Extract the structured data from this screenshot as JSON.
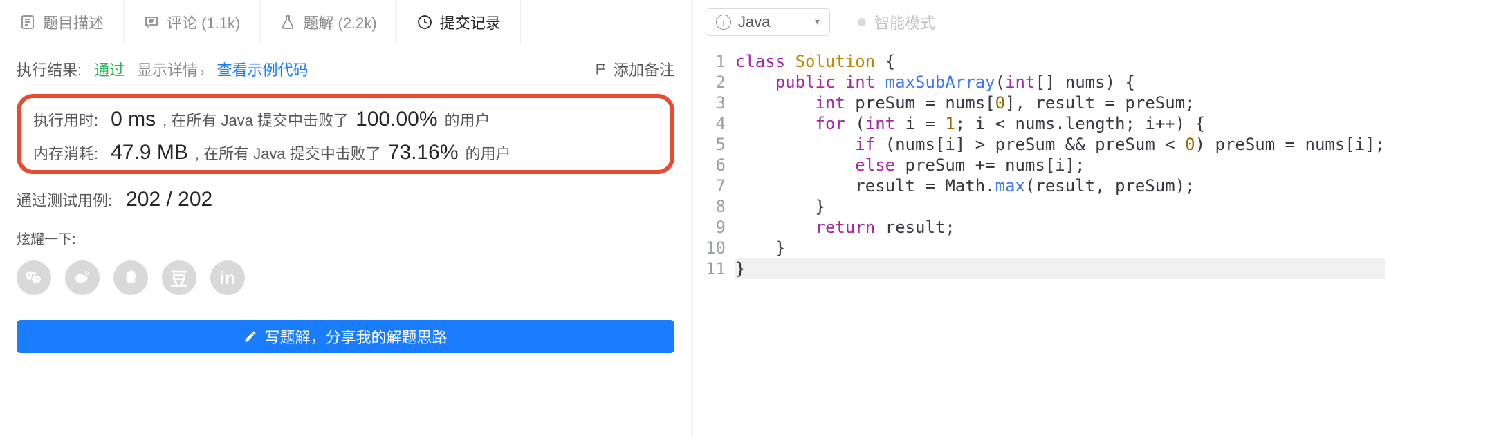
{
  "tabs": {
    "description": "题目描述",
    "comments": "评论 (1.1k)",
    "solutions": "题解 (2.2k)",
    "submissions": "提交记录"
  },
  "result": {
    "label": "执行结果:",
    "status": "通过",
    "show_details": "显示详情",
    "view_sample_code": "查看示例代码",
    "add_note": "添加备注"
  },
  "runtime": {
    "label": "执行用时:",
    "value": "0 ms",
    "prefix": ", 在所有 Java 提交中击败了",
    "percent": "100.00%",
    "suffix": "的用户"
  },
  "memory": {
    "label": "内存消耗:",
    "value": "47.9 MB",
    "prefix": ", 在所有 Java 提交中击败了",
    "percent": "73.16%",
    "suffix": "的用户"
  },
  "testcases": {
    "label": "通过测试用例:",
    "value": "202 / 202"
  },
  "share": {
    "label": "炫耀一下:"
  },
  "write_solution": "写题解，分享我的解题思路",
  "editor": {
    "language": "Java",
    "smart_mode": "智能模式",
    "lines": [
      "1",
      "2",
      "3",
      "4",
      "5",
      "6",
      "7",
      "8",
      "9",
      "10",
      "11"
    ]
  },
  "code_tokens": [
    [
      [
        "k",
        "class"
      ],
      [
        "",
        " "
      ],
      [
        "cls",
        "Solution"
      ],
      [
        "",
        " {"
      ]
    ],
    [
      [
        "",
        "    "
      ],
      [
        "k",
        "public"
      ],
      [
        "",
        " "
      ],
      [
        "t",
        "int"
      ],
      [
        "",
        " "
      ],
      [
        "fn",
        "maxSubArray"
      ],
      [
        "",
        "("
      ],
      [
        "t",
        "int"
      ],
      [
        "",
        "[] nums) {"
      ]
    ],
    [
      [
        "",
        "        "
      ],
      [
        "t",
        "int"
      ],
      [
        "",
        " preSum = nums["
      ],
      [
        "num",
        "0"
      ],
      [
        "",
        "], result = preSum;"
      ]
    ],
    [
      [
        "",
        "        "
      ],
      [
        "k",
        "for"
      ],
      [
        "",
        " ("
      ],
      [
        "t",
        "int"
      ],
      [
        "",
        " i = "
      ],
      [
        "num",
        "1"
      ],
      [
        "",
        "; i < nums.length; i++) {"
      ]
    ],
    [
      [
        "",
        "            "
      ],
      [
        "k",
        "if"
      ],
      [
        "",
        " (nums[i] > preSum && preSum < "
      ],
      [
        "num",
        "0"
      ],
      [
        "",
        ") preSum = nums[i];"
      ]
    ],
    [
      [
        "",
        "            "
      ],
      [
        "k",
        "else"
      ],
      [
        "",
        " preSum += nums[i];"
      ]
    ],
    [
      [
        "",
        "            result = Math."
      ],
      [
        "fn",
        "max"
      ],
      [
        "",
        "(result, preSum);"
      ]
    ],
    [
      [
        "",
        "        }"
      ]
    ],
    [
      [
        "",
        "        "
      ],
      [
        "k",
        "return"
      ],
      [
        "",
        " result;"
      ]
    ],
    [
      [
        "",
        "    }"
      ]
    ],
    [
      [
        "",
        "}"
      ]
    ]
  ]
}
